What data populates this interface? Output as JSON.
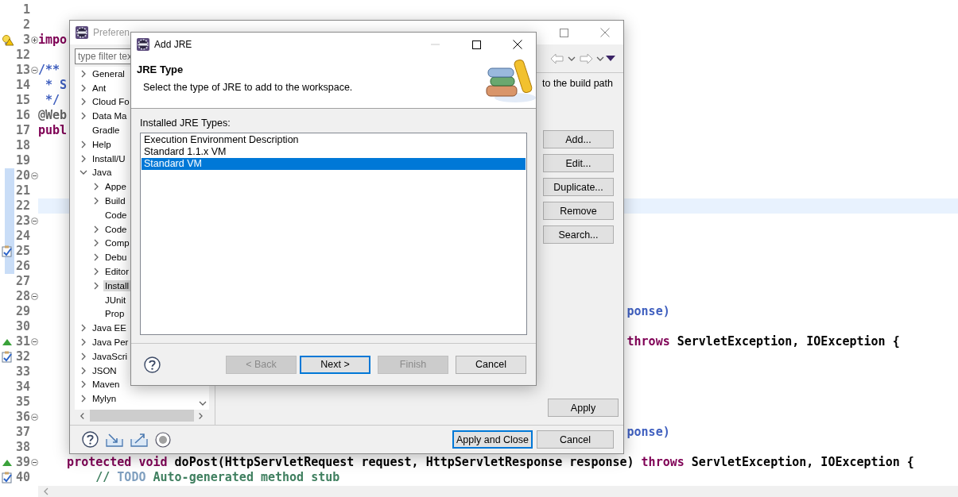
{
  "editor": {
    "lines": [
      {
        "number": "1",
        "in_range": false,
        "current": false
      },
      {
        "number": "2",
        "in_range": false,
        "current": false
      },
      {
        "number": "3",
        "fold": {
          "collapsed": true
        },
        "marker": {
          "kind": "warning"
        },
        "in_range": false,
        "current": false,
        "left": [
          {
            "kind": "keyword",
            "text": "impo"
          }
        ]
      },
      {
        "number": "12",
        "in_range": false,
        "current": false
      },
      {
        "number": "13",
        "fold": {
          "collapsed": false
        },
        "in_range": false,
        "current": false,
        "left": [
          {
            "kind": "javadoc",
            "text": "/**"
          }
        ]
      },
      {
        "number": "14",
        "in_range": false,
        "current": false,
        "left": [
          {
            "kind": "javadoc",
            "text": " * S"
          }
        ]
      },
      {
        "number": "15",
        "in_range": false,
        "current": false,
        "left": [
          {
            "kind": "javadoc",
            "text": " */"
          }
        ]
      },
      {
        "number": "16",
        "in_range": false,
        "current": false,
        "left": [
          {
            "kind": "annotation",
            "text": "@Web"
          }
        ]
      },
      {
        "number": "17",
        "in_range": false,
        "current": false,
        "left": [
          {
            "kind": "keyword",
            "text": "publ"
          }
        ]
      },
      {
        "number": "18",
        "in_range": false,
        "current": false
      },
      {
        "number": "19",
        "in_range": false,
        "current": false
      },
      {
        "number": "20",
        "fold": {
          "collapsed": false
        },
        "in_range": true,
        "current": false
      },
      {
        "number": "21",
        "in_range": true,
        "current": false
      },
      {
        "number": "22",
        "in_range": true,
        "current": true
      },
      {
        "number": "23",
        "fold": {
          "collapsed": false
        },
        "in_range": true,
        "current": false
      },
      {
        "number": "24",
        "in_range": true,
        "current": false
      },
      {
        "number": "25",
        "marker": {
          "kind": "task"
        },
        "in_range": true,
        "current": false
      },
      {
        "number": "26",
        "in_range": true,
        "current": false
      },
      {
        "number": "27",
        "in_range": false,
        "current": false
      },
      {
        "number": "28",
        "fold": {
          "collapsed": false
        },
        "in_range": false,
        "current": false
      },
      {
        "number": "29",
        "in_range": false,
        "current": false,
        "right": [
          {
            "kind": "javadoc",
            "text": "ponse)"
          }
        ]
      },
      {
        "number": "30",
        "in_range": false,
        "current": false
      },
      {
        "number": "31",
        "fold": {
          "collapsed": false
        },
        "marker": {
          "kind": "override"
        },
        "in_range": false,
        "current": false,
        "right": [
          {
            "kind": "keyword",
            "text": "throws"
          },
          {
            "kind": "plain",
            "text": " ServletException, IOException {"
          }
        ]
      },
      {
        "number": "32",
        "marker": {
          "kind": "task"
        },
        "in_range": false,
        "current": false
      },
      {
        "number": "33",
        "in_range": false,
        "current": false
      },
      {
        "number": "34",
        "in_range": false,
        "current": false
      },
      {
        "number": "35",
        "in_range": false,
        "current": false
      },
      {
        "number": "36",
        "fold": {
          "collapsed": false
        },
        "in_range": false,
        "current": false
      },
      {
        "number": "37",
        "in_range": false,
        "current": false,
        "right": [
          {
            "kind": "javadoc",
            "text": "ponse)"
          }
        ]
      },
      {
        "number": "38",
        "in_range": false,
        "current": false
      },
      {
        "number": "39",
        "fold": {
          "collapsed": false
        },
        "marker": {
          "kind": "override"
        },
        "in_range": false,
        "current": false,
        "left": [
          {
            "kind": "keyword",
            "text": "    protected void"
          },
          {
            "kind": "plain",
            "text": " doPost(HttpServletRequest request, HttpServletResponse response) "
          },
          {
            "kind": "keyword",
            "text": "throws"
          },
          {
            "kind": "plain",
            "text": " ServletException, IOException {"
          }
        ]
      },
      {
        "number": "40",
        "marker": {
          "kind": "task"
        },
        "in_range": false,
        "current": false,
        "left": [
          {
            "kind": "comment",
            "text": "        // "
          },
          {
            "kind": "todo",
            "text": "TODO"
          },
          {
            "kind": "comment",
            "text": " Auto-generated method stub"
          }
        ]
      }
    ]
  },
  "preferences": {
    "title": "Preferen",
    "filter": {
      "placeholder": "type filter tex"
    },
    "tree": [
      {
        "label": "General",
        "kind": "folder",
        "expanded": false,
        "selected": false
      },
      {
        "label": "Ant",
        "kind": "folder",
        "expanded": false,
        "selected": false
      },
      {
        "label": "Cloud Fo",
        "kind": "folder",
        "expanded": false,
        "selected": false
      },
      {
        "label": "Data Ma",
        "kind": "folder",
        "expanded": false,
        "selected": false
      },
      {
        "label": "Gradle",
        "kind": "leaf",
        "selected": false
      },
      {
        "label": "Help",
        "kind": "folder",
        "expanded": false,
        "selected": false
      },
      {
        "label": "Install/U",
        "kind": "folder",
        "expanded": false,
        "selected": false
      },
      {
        "label": "Java",
        "kind": "folder",
        "expanded": true,
        "selected": false,
        "children": [
          {
            "label": "Appe",
            "kind": "folder",
            "expanded": false,
            "selected": false
          },
          {
            "label": "Build",
            "kind": "folder",
            "expanded": false,
            "selected": false
          },
          {
            "label": "Code",
            "kind": "leaf",
            "selected": false
          },
          {
            "label": "Code",
            "kind": "folder",
            "expanded": false,
            "selected": false
          },
          {
            "label": "Comp",
            "kind": "folder",
            "expanded": false,
            "selected": false
          },
          {
            "label": "Debu",
            "kind": "folder",
            "expanded": false,
            "selected": false
          },
          {
            "label": "Editor",
            "kind": "folder",
            "expanded": false,
            "selected": false
          },
          {
            "label": "Install",
            "kind": "folder",
            "expanded": false,
            "selected": true
          },
          {
            "label": "JUnit",
            "kind": "leaf",
            "selected": false
          },
          {
            "label": "Prop",
            "kind": "leaf",
            "selected": false
          }
        ]
      },
      {
        "label": "Java EE",
        "kind": "folder",
        "expanded": false,
        "selected": false
      },
      {
        "label": "Java Per",
        "kind": "folder",
        "expanded": false,
        "selected": false
      },
      {
        "label": "JavaScri",
        "kind": "folder",
        "expanded": false,
        "selected": false
      },
      {
        "label": "JSON",
        "kind": "folder",
        "expanded": false,
        "selected": false
      },
      {
        "label": "Maven",
        "kind": "folder",
        "expanded": false,
        "selected": false
      },
      {
        "label": "Mylyn",
        "kind": "folder",
        "expanded": false,
        "selected": false
      }
    ],
    "back_disabled": true,
    "forward_disabled": true,
    "description": "to the build path",
    "side_buttons": [
      "Add...",
      "Edit...",
      "Duplicate...",
      "Remove",
      "Search..."
    ],
    "apply": "Apply",
    "footer_buttons": [
      {
        "label": "Apply and Close",
        "focused": true
      },
      {
        "label": "Cancel",
        "focused": false
      }
    ]
  },
  "dialog": {
    "title": "Add JRE",
    "minimize_disabled": true,
    "heading": "JRE Type",
    "message": "Select the type of JRE to add to the workspace.",
    "list_label": "Installed JRE Types:",
    "jre_types": [
      {
        "label": "Execution Environment Description",
        "selected": false
      },
      {
        "label": "Standard 1.1.x VM",
        "selected": false
      },
      {
        "label": "Standard VM",
        "selected": true
      }
    ],
    "buttons": [
      {
        "label": "< Back",
        "disabled": true,
        "focused": false
      },
      {
        "label": "Next >",
        "disabled": false,
        "focused": true
      },
      {
        "label": "Finish",
        "disabled": true,
        "focused": false
      },
      {
        "label": "Cancel",
        "disabled": false,
        "focused": false
      }
    ]
  }
}
